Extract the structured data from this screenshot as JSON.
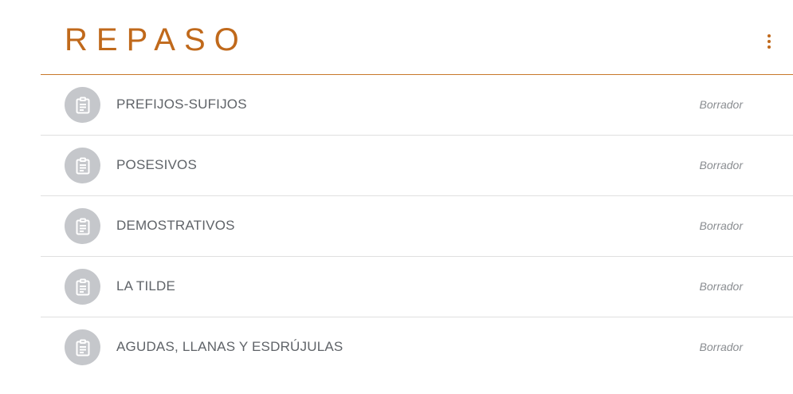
{
  "section": {
    "title": "REPASO",
    "more_icon": "more-vert-icon",
    "accent_color": "#c0691b"
  },
  "assignments": [
    {
      "title": "PREFIJOS-SUFIJOS",
      "status": "Borrador",
      "icon": "assignment-icon"
    },
    {
      "title": "POSESIVOS",
      "status": "Borrador",
      "icon": "assignment-icon"
    },
    {
      "title": "DEMOSTRATIVOS",
      "status": "Borrador",
      "icon": "assignment-icon"
    },
    {
      "title": "LA TILDE",
      "status": "Borrador",
      "icon": "assignment-icon"
    },
    {
      "title": "AGUDAS, LLANAS Y ESDRÚJULAS",
      "status": "Borrador",
      "icon": "assignment-icon"
    }
  ]
}
